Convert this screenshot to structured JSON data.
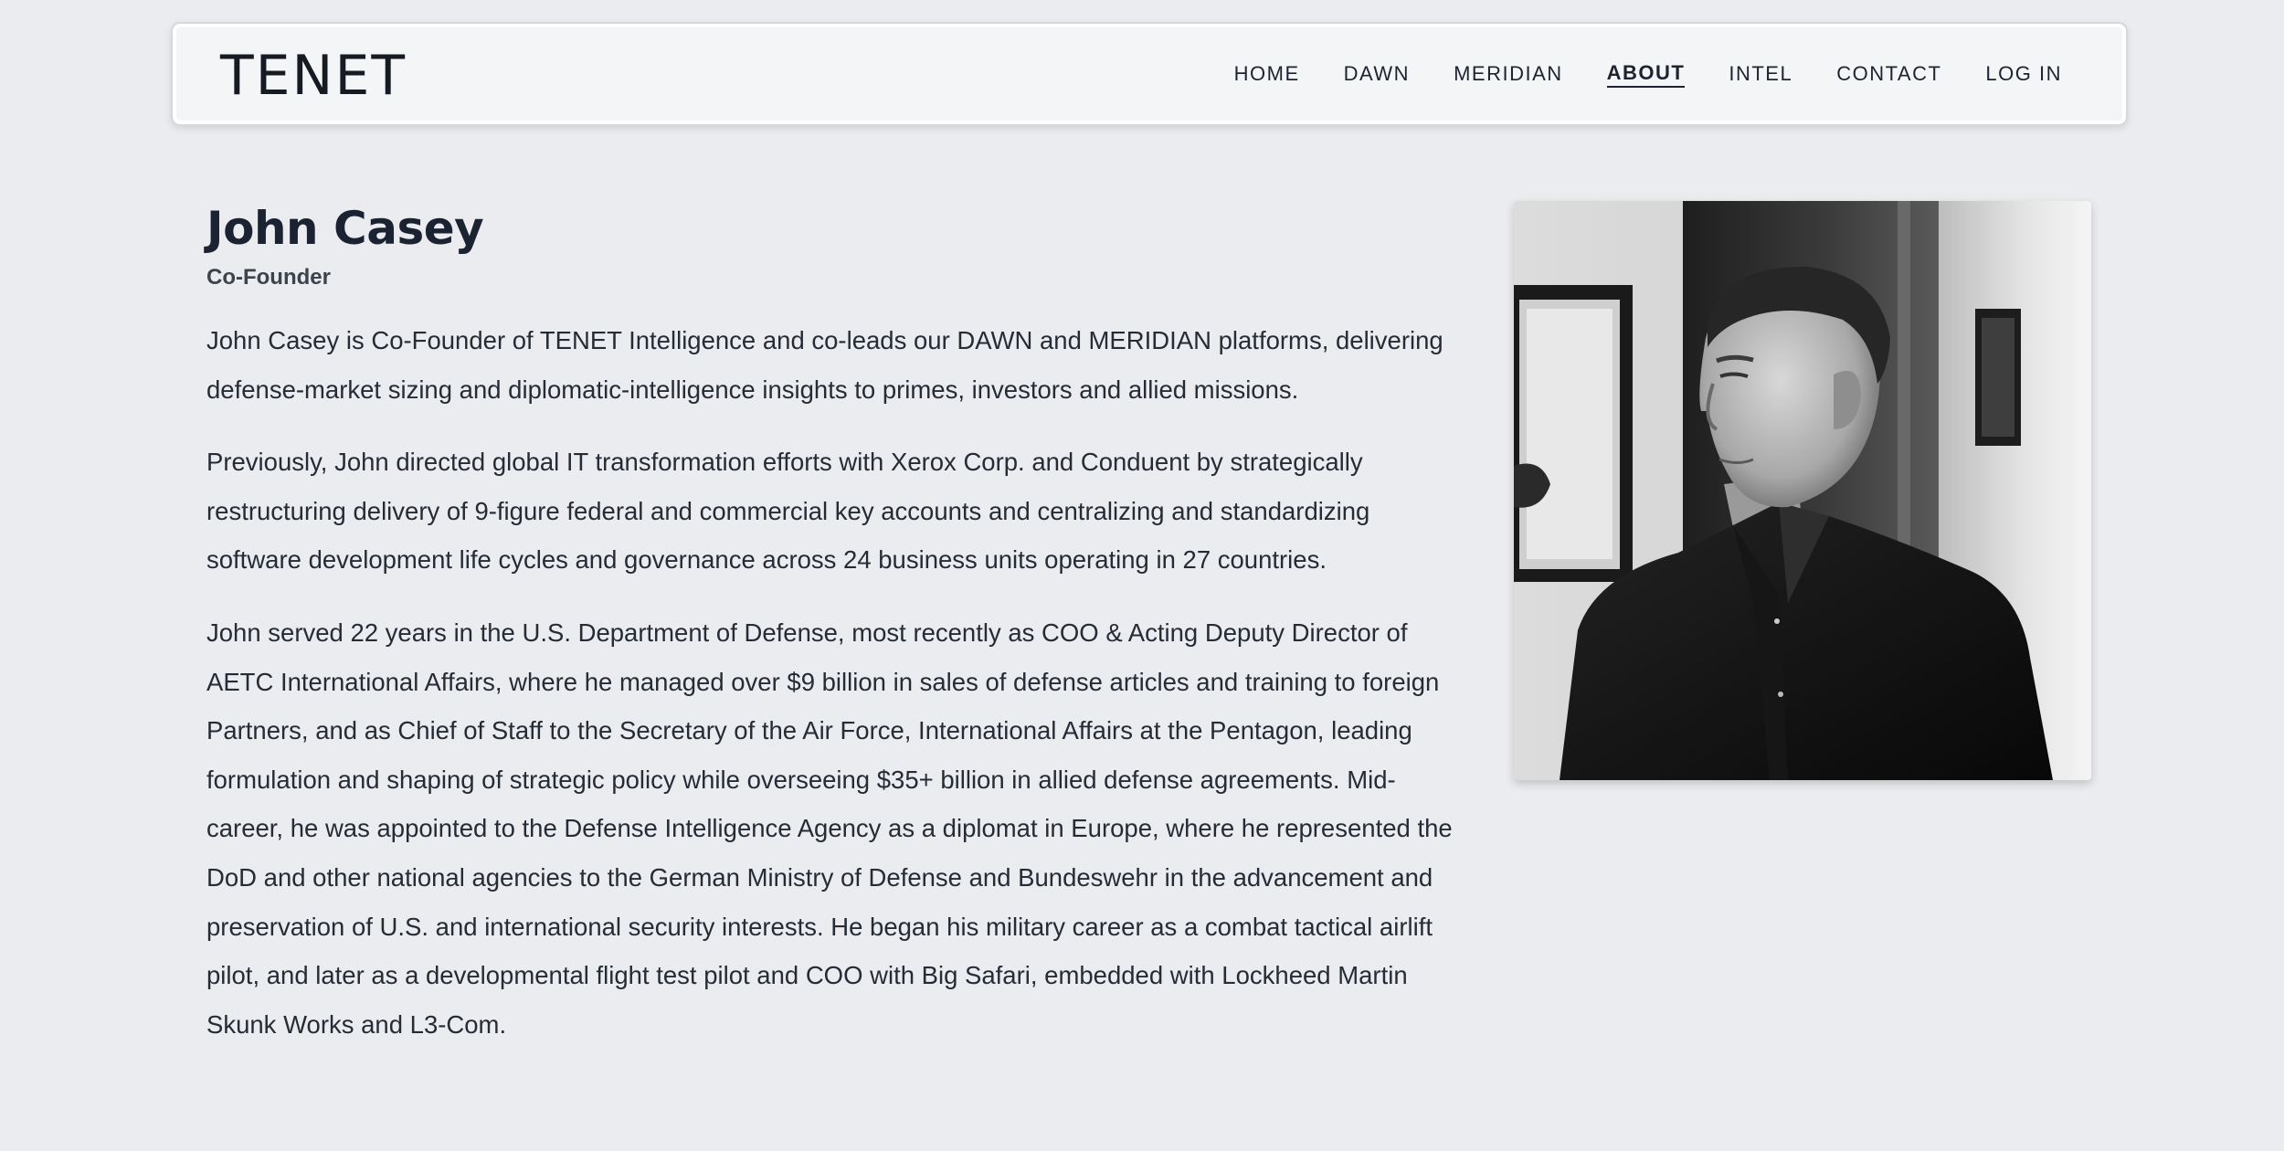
{
  "brand": {
    "logo_text": "TENET"
  },
  "nav": {
    "items": [
      {
        "label": "HOME"
      },
      {
        "label": "DAWN"
      },
      {
        "label": "MERIDIAN"
      },
      {
        "label": "ABOUT",
        "active": true
      },
      {
        "label": "INTEL"
      },
      {
        "label": "CONTACT"
      },
      {
        "label": "LOG IN"
      }
    ]
  },
  "profile": {
    "name": "John Casey",
    "role": "Co-Founder",
    "bio": [
      "John Casey is Co-Founder of TENET Intelligence and co-leads our DAWN and MERIDIAN platforms, delivering defense-market sizing and diplomatic-intelligence insights to primes, investors and allied missions.",
      "Previously, John directed global IT transformation efforts with Xerox Corp. and Conduent by strategically restructuring delivery of 9-figure federal and commercial key accounts and centralizing and standardizing software development life cycles and governance across 24 business units operating in 27 countries.",
      "John served 22 years in the U.S. Department of Defense, most recently as COO & Acting Deputy Director of AETC International Affairs, where he managed over $9 billion in sales of defense articles and training to foreign Partners, and as Chief of Staff to the Secretary of the Air Force, International Affairs at the Pentagon, leading formulation and shaping of strategic policy while overseeing $35+ billion in allied defense agreements. Mid-career, he was appointed to the Defense Intelligence Agency as a diplomat in Europe, where he represented the DoD and other national agencies to the German Ministry of Defense and Bundeswehr in the advancement and preservation of U.S. and international security interests. He began his military career as a combat tactical airlift pilot, and later as a developmental flight test pilot and COO with Big Safari, embedded with Lockheed Martin Skunk Works and L3-Com."
    ]
  },
  "colors": {
    "page_background": "#ebecef",
    "navbar_background": "#f4f5f7",
    "text": "#1d2330"
  }
}
